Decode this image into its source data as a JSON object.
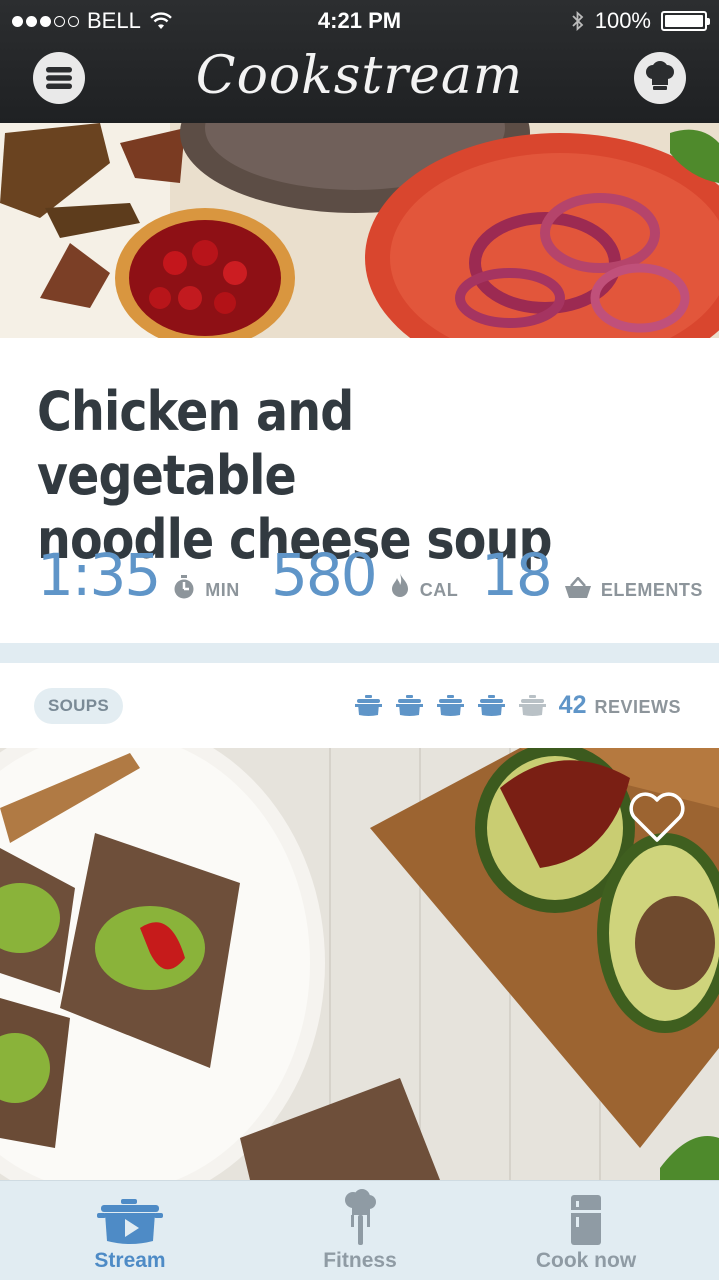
{
  "status_bar": {
    "carrier": "BELL",
    "time": "4:21 PM",
    "battery": "100%"
  },
  "header": {
    "app_title": "Cookstream"
  },
  "recipe": {
    "title_line1": "Chicken and vegetable",
    "title_line2": "noodle cheese soup",
    "stats": [
      {
        "value": "1:35",
        "unit": "MIN",
        "icon": "timer-icon"
      },
      {
        "value": "580",
        "unit": "CAL",
        "icon": "flame-icon"
      },
      {
        "value": "18",
        "unit": "ELEMENTS",
        "icon": "basket-icon"
      }
    ],
    "tag": "SOUPS",
    "difficulty": {
      "filled": 4,
      "total": 5
    },
    "reviews_count": "42",
    "reviews_label": "REVIEWS"
  },
  "tabbar": {
    "items": [
      {
        "label": "Stream",
        "icon": "stream-pot-icon",
        "active": true
      },
      {
        "label": "Fitness",
        "icon": "chef-fork-icon",
        "active": false
      },
      {
        "label": "Cook now",
        "icon": "fridge-icon",
        "active": false
      }
    ]
  },
  "colors": {
    "accent": "#5f95c8",
    "title": "#323a40",
    "muted": "#8d959b",
    "divider": "#e1ecf2",
    "header_bg": "#262829"
  }
}
